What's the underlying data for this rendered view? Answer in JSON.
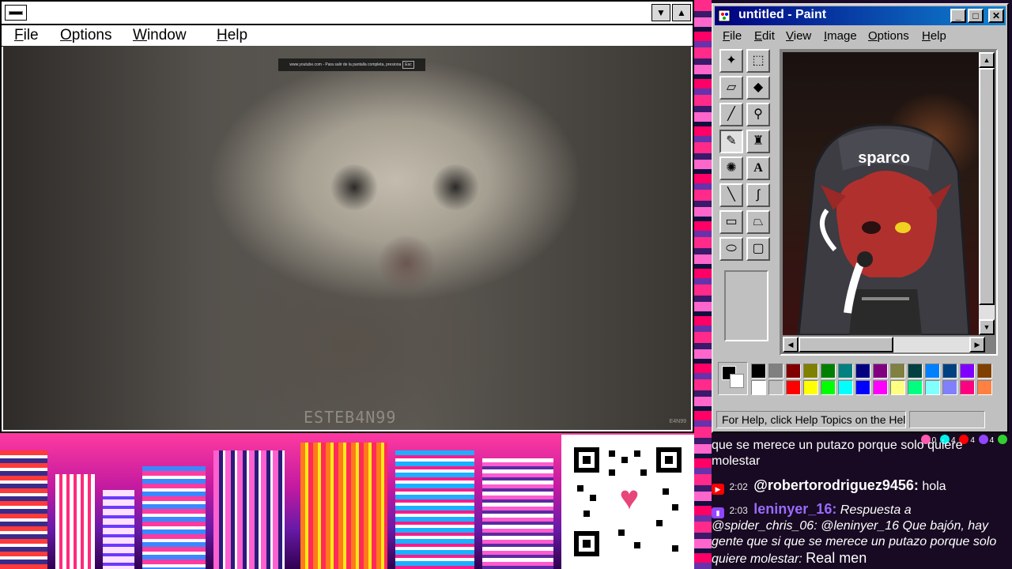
{
  "left_window": {
    "menu": [
      "File",
      "Options",
      "Window",
      "Help"
    ],
    "video": {
      "fullscreen_notice": "www.youtube.com - Para salir de la pantalla completa, presiona",
      "esc_key": "Esc",
      "watermark": "ESTEB4N99",
      "corner_text": "E4N99"
    }
  },
  "paint": {
    "title": "untitled - Paint",
    "menu": [
      "File",
      "Edit",
      "View",
      "Image",
      "Options",
      "Help"
    ],
    "canvas_logo": "sparco",
    "status_text": "For Help, click Help Topics on the Help Menu.",
    "palette_top": [
      "#000000",
      "#808080",
      "#800000",
      "#808000",
      "#008000",
      "#008080",
      "#000080",
      "#800080",
      "#808040",
      "#004040",
      "#0080ff",
      "#004080",
      "#8000ff",
      "#804000"
    ],
    "palette_bottom": [
      "#ffffff",
      "#c0c0c0",
      "#ff0000",
      "#ffff00",
      "#00ff00",
      "#00ffff",
      "#0000ff",
      "#ff00ff",
      "#ffff80",
      "#00ff80",
      "#80ffff",
      "#8080ff",
      "#ff0080",
      "#ff8040"
    ],
    "fg_color": "#000000",
    "bg_color": "#ffffff"
  },
  "chat": {
    "viewer_counts": [
      "0",
      "4",
      "4",
      "4"
    ],
    "messages": [
      {
        "text": "que se merece un putazo porque solo quiere molestar"
      },
      {
        "platform": "youtube",
        "time": "2:02",
        "user": "@robertorodriguez9456:",
        "text": "hola"
      },
      {
        "platform": "twitch",
        "time": "2:03",
        "user": "leninyer_16:",
        "reply": "Respuesta a @spider_chris_06: @leninyer_16 Que bajón, hay gente que si que se merece un putazo porque solo quiere molestar:",
        "text": "Real men"
      }
    ]
  },
  "colors": {
    "paint_title_start": "#000080",
    "paint_title_end": "#1084d0",
    "twitch_purple": "#9146ff",
    "youtube_red": "#ff0000",
    "chat_bg": "#170a22"
  }
}
